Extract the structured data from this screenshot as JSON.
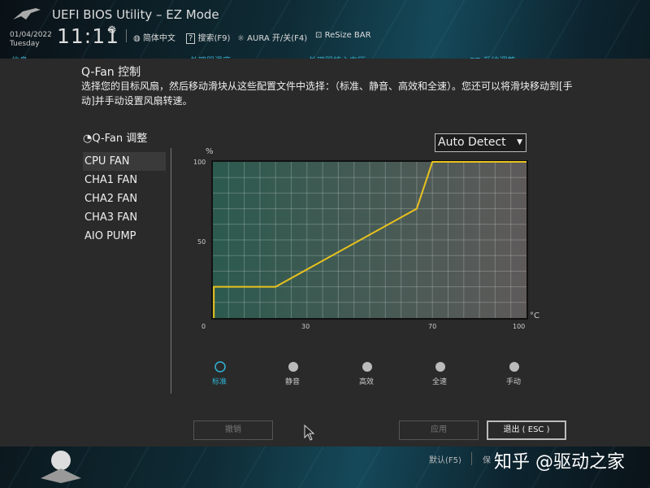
{
  "header": {
    "title": "UEFI BIOS Utility – EZ Mode",
    "date": "01/04/2022",
    "weekday": "Tuesday",
    "time": "11:11",
    "toolbar": [
      {
        "icon": "globe-icon",
        "label": "简体中文"
      },
      {
        "icon": "help-icon",
        "label": "搜索(F9)"
      },
      {
        "icon": "aura-icon",
        "label": "AURA 开/关(F4)"
      },
      {
        "icon": "resize-bar-icon",
        "label": "ReSize BAR"
      }
    ],
    "tabs": [
      "信息",
      "处理器温度",
      "处理器核心电压",
      "EZ 系统调整"
    ]
  },
  "panel": {
    "title": "Q-Fan 控制",
    "description": "选择您的目标风扇，然后移动滑块从这些配置文件中选择：（标准、静音、高效和全速）。您还可以将滑块移动到[手动]并手动设置风扇转速。",
    "fan_header": "Q-Fan 调整",
    "fans": [
      "CPU FAN",
      "CHA1 FAN",
      "CHA2 FAN",
      "CHA3 FAN",
      "AIO PUMP"
    ],
    "selected_fan": "CPU FAN",
    "source_select": "Auto Detect",
    "profiles": [
      "标准",
      "静音",
      "高效",
      "全速",
      "手动"
    ],
    "selected_profile": "标准",
    "buttons": {
      "undo": "撤销",
      "apply": "应用",
      "exit": "退出 ( ESC )"
    }
  },
  "chart_data": {
    "type": "line",
    "xlabel": "°C",
    "ylabel": "%",
    "xlim": [
      0,
      100
    ],
    "ylim": [
      0,
      100
    ],
    "xticks": [
      "0",
      "30",
      "70",
      "100"
    ],
    "yticks": [
      "0",
      "50",
      "100"
    ],
    "grid": true,
    "series": [
      {
        "x": [
          0.3,
          0.3,
          20,
          65,
          70,
          100
        ],
        "y": [
          0,
          20,
          20,
          70,
          100,
          100
        ],
        "color": "#e8c21e"
      }
    ]
  },
  "footer": {
    "default": "默认(F5)",
    "save_partial": "保",
    "watermark": "知乎 @驱动之家"
  },
  "colors": {
    "accent": "#2fb4d6",
    "curve": "#e8c21e"
  }
}
